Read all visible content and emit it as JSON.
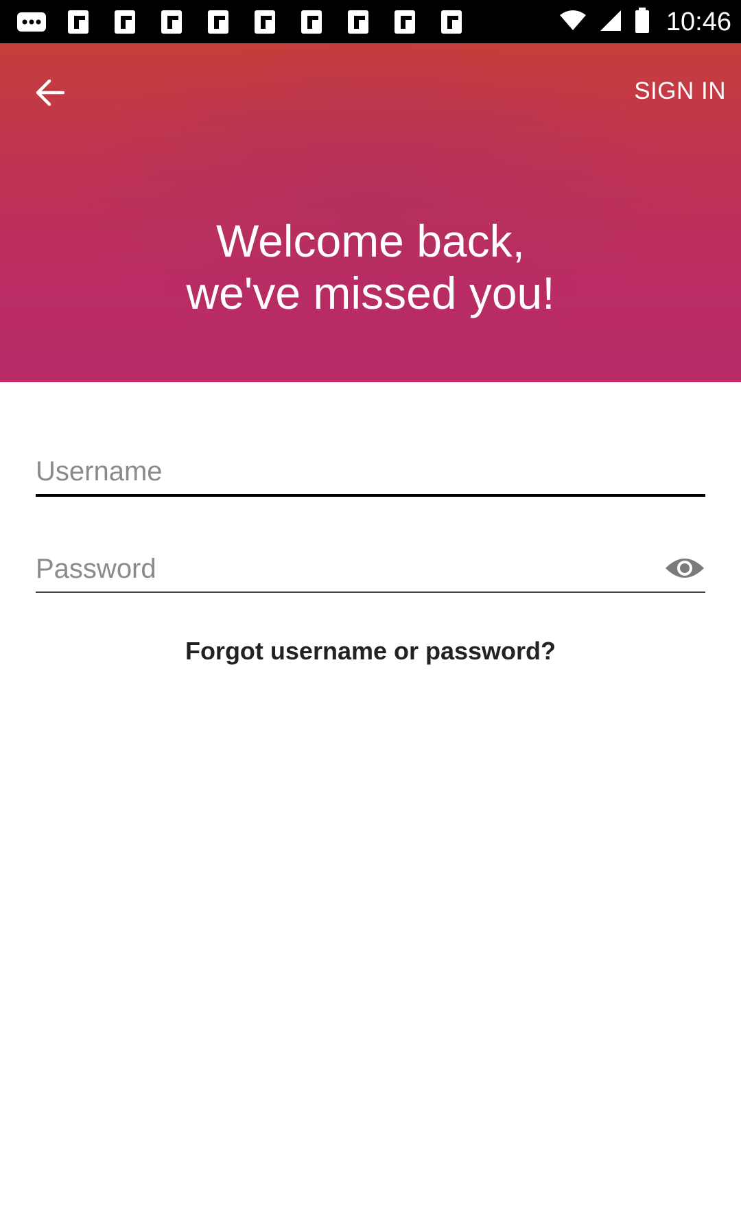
{
  "status_bar": {
    "notification_icons": [
      "more-icon",
      "flipboard-icon",
      "flipboard-icon",
      "flipboard-icon",
      "flipboard-icon",
      "flipboard-icon",
      "flipboard-icon",
      "flipboard-icon",
      "flipboard-icon",
      "flipboard-icon"
    ],
    "time": "10:46"
  },
  "header": {
    "back_icon": "arrow-left-icon",
    "action_label": "SIGN IN",
    "welcome_line1": "Welcome back,",
    "welcome_line2": "we've missed you!",
    "gradient_top": "#c53e3a",
    "gradient_bottom": "#b72a66"
  },
  "form": {
    "username_placeholder": "Username",
    "password_placeholder": "Password",
    "visibility_icon": "eye-icon",
    "forgot_label": "Forgot username or password?"
  }
}
